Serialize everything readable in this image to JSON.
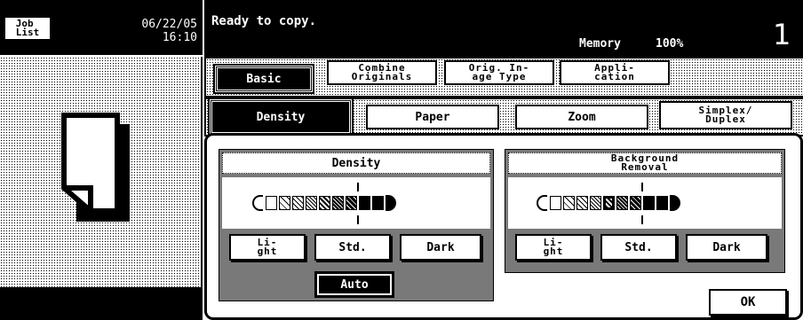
{
  "header": {
    "job_list_label": "Job\nList",
    "date": "06/22/05",
    "time": "16:10",
    "status": "Ready to copy.",
    "memory_label": "Memory",
    "memory_value": "100%",
    "copies": "1"
  },
  "main_tabs": [
    {
      "label": "Basic"
    },
    {
      "label": "Combine\nOriginals"
    },
    {
      "label": "Orig. In-\nage Type"
    },
    {
      "label": "Appli-\ncation"
    }
  ],
  "sub_tabs": [
    {
      "label": "Density"
    },
    {
      "label": "Paper"
    },
    {
      "label": "Zoom"
    },
    {
      "label": "Simplex/\nDuplex"
    }
  ],
  "density_panel": {
    "title": "Density",
    "light": "Li-\nght",
    "std": "Std.",
    "dark": "Dark",
    "auto": "Auto"
  },
  "background_panel": {
    "title": "Background\nRemoval",
    "light": "Li-\nght",
    "std": "Std.",
    "dark": "Dark"
  },
  "ok_label": "OK"
}
